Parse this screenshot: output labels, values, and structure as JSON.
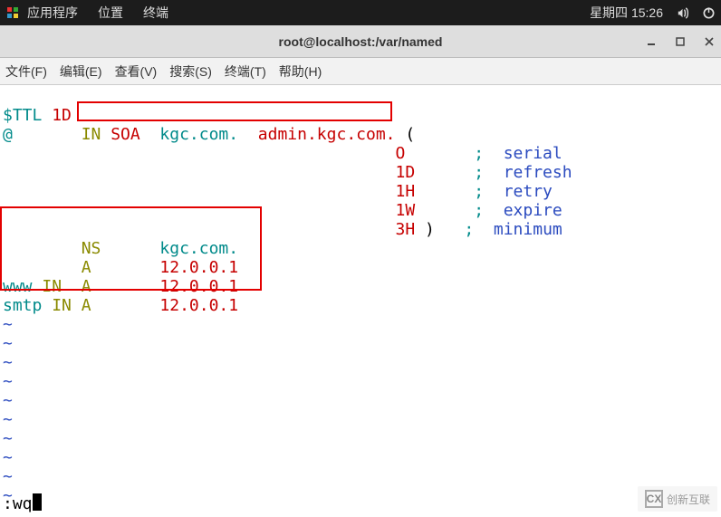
{
  "panel": {
    "apps": "应用程序",
    "places": "位置",
    "terminal": "终端",
    "datetime": "星期四 15:26"
  },
  "titlebar": {
    "title": "root@localhost:/var/named"
  },
  "menubar": {
    "file": "文件(F)",
    "edit": "编辑(E)",
    "view": "查看(V)",
    "search": "搜索(S)",
    "terminal": "终端(T)",
    "help": "帮助(H)"
  },
  "content": {
    "l1_a": "$TTL ",
    "l1_b": "1D",
    "l2_a": "@       ",
    "l2_b": "IN ",
    "l2_c": "SOA  ",
    "l2_d": "kgc.com. ",
    "l2_e": " admin.kgc.com. ",
    "l2_f": "(",
    "l3_a": "                                        ",
    "l3_b": "O       ",
    "l3_c": "; ",
    "l3_d": " serial",
    "l4_a": "                                        ",
    "l4_b": "1D      ",
    "l4_c": "; ",
    "l4_d": " refresh",
    "l5_a": "                                        ",
    "l5_b": "1H      ",
    "l5_c": "; ",
    "l5_d": " retry",
    "l6_a": "                                        ",
    "l6_b": "1W      ",
    "l6_c": "; ",
    "l6_d": " expire",
    "l7_a": "                                        ",
    "l7_b": "3H ",
    "l7_c": ")   ",
    "l7_d": "; ",
    "l7_e": " minimum",
    "l8_a": "        ",
    "l8_b": "NS      ",
    "l8_c": "kgc.com.",
    "l9_a": "        ",
    "l9_b": "A       ",
    "l9_c": "12.0.0.1",
    "l10_a": "www ",
    "l10_b": "IN  ",
    "l10_c": "A       ",
    "l10_d": "12.0.0.1",
    "l11_a": "smtp ",
    "l11_b": "IN ",
    "l11_c": "A       ",
    "l11_d": "12.0.0.1",
    "tilde": "~"
  },
  "status": {
    "cmd": ":wq"
  },
  "watermark": {
    "logo": "CX",
    "text": "创新互联"
  }
}
